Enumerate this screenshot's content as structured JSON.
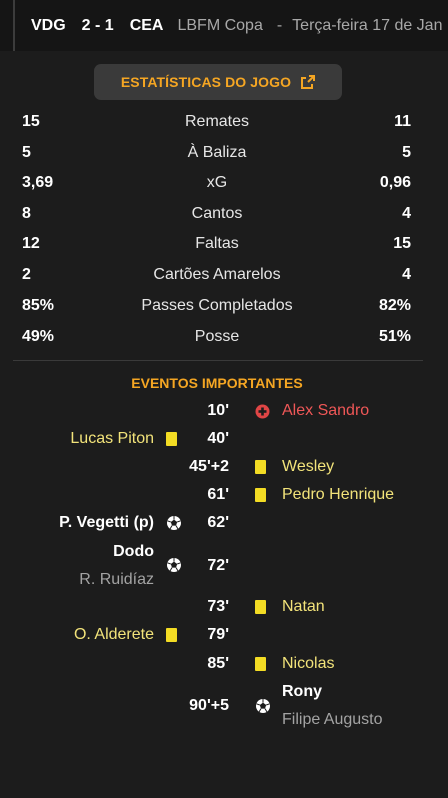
{
  "header": {
    "home": "VDG",
    "score": "2 - 1",
    "away": "CEA",
    "competition": "LBFM Copa",
    "separator": "-",
    "date": "Terça-feira 17 de Jan"
  },
  "stats_button": {
    "label": "ESTATÍSTICAS DO JOGO",
    "icon": "external-link-icon"
  },
  "stats": [
    {
      "label": "Remates",
      "home": "15",
      "away": "11"
    },
    {
      "label": "À Baliza",
      "home": "5",
      "away": "5"
    },
    {
      "label": "xG",
      "home": "3,69",
      "away": "0,96"
    },
    {
      "label": "Cantos",
      "home": "8",
      "away": "4"
    },
    {
      "label": "Faltas",
      "home": "12",
      "away": "15"
    },
    {
      "label": "Cartões Amarelos",
      "home": "2",
      "away": "4"
    },
    {
      "label": "Passes Completados",
      "home": "85%",
      "away": "82%"
    },
    {
      "label": "Posse",
      "home": "49%",
      "away": "51%"
    }
  ],
  "events_title": "EVENTOS IMPORTANTES",
  "events": [
    {
      "minute": "10'",
      "side": "away",
      "type": "injury",
      "icon": "injury-cross-icon",
      "player": "Alex Sandro"
    },
    {
      "minute": "40'",
      "side": "home",
      "type": "yellow",
      "icon": "yellow-card-icon",
      "player": "Lucas Piton"
    },
    {
      "minute": "45'+2",
      "side": "away",
      "type": "yellow",
      "icon": "yellow-card-icon",
      "player": "Wesley"
    },
    {
      "minute": "61'",
      "side": "away",
      "type": "yellow",
      "icon": "yellow-card-icon",
      "player": "Pedro Henrique"
    },
    {
      "minute": "62'",
      "side": "home",
      "type": "goal",
      "icon": "ball-icon",
      "player": "P. Vegetti (p)"
    },
    {
      "minute": "72'",
      "side": "home",
      "type": "goal",
      "icon": "ball-icon",
      "player": "Dodo",
      "assist": "R. Ruidíaz"
    },
    {
      "minute": "73'",
      "side": "away",
      "type": "yellow",
      "icon": "yellow-card-icon",
      "player": "Natan"
    },
    {
      "minute": "79'",
      "side": "home",
      "type": "yellow",
      "icon": "yellow-card-icon",
      "player": "O. Alderete"
    },
    {
      "minute": "85'",
      "side": "away",
      "type": "yellow",
      "icon": "yellow-card-icon",
      "player": "Nicolas"
    },
    {
      "minute": "90'+5",
      "side": "away",
      "type": "goal",
      "icon": "ball-icon",
      "player": "Rony",
      "assist": "Filipe Augusto"
    }
  ],
  "colors": {
    "accent": "#f5a623",
    "card": "#f3dc24",
    "injury": "#e04545",
    "background": "#1c1c1c"
  }
}
